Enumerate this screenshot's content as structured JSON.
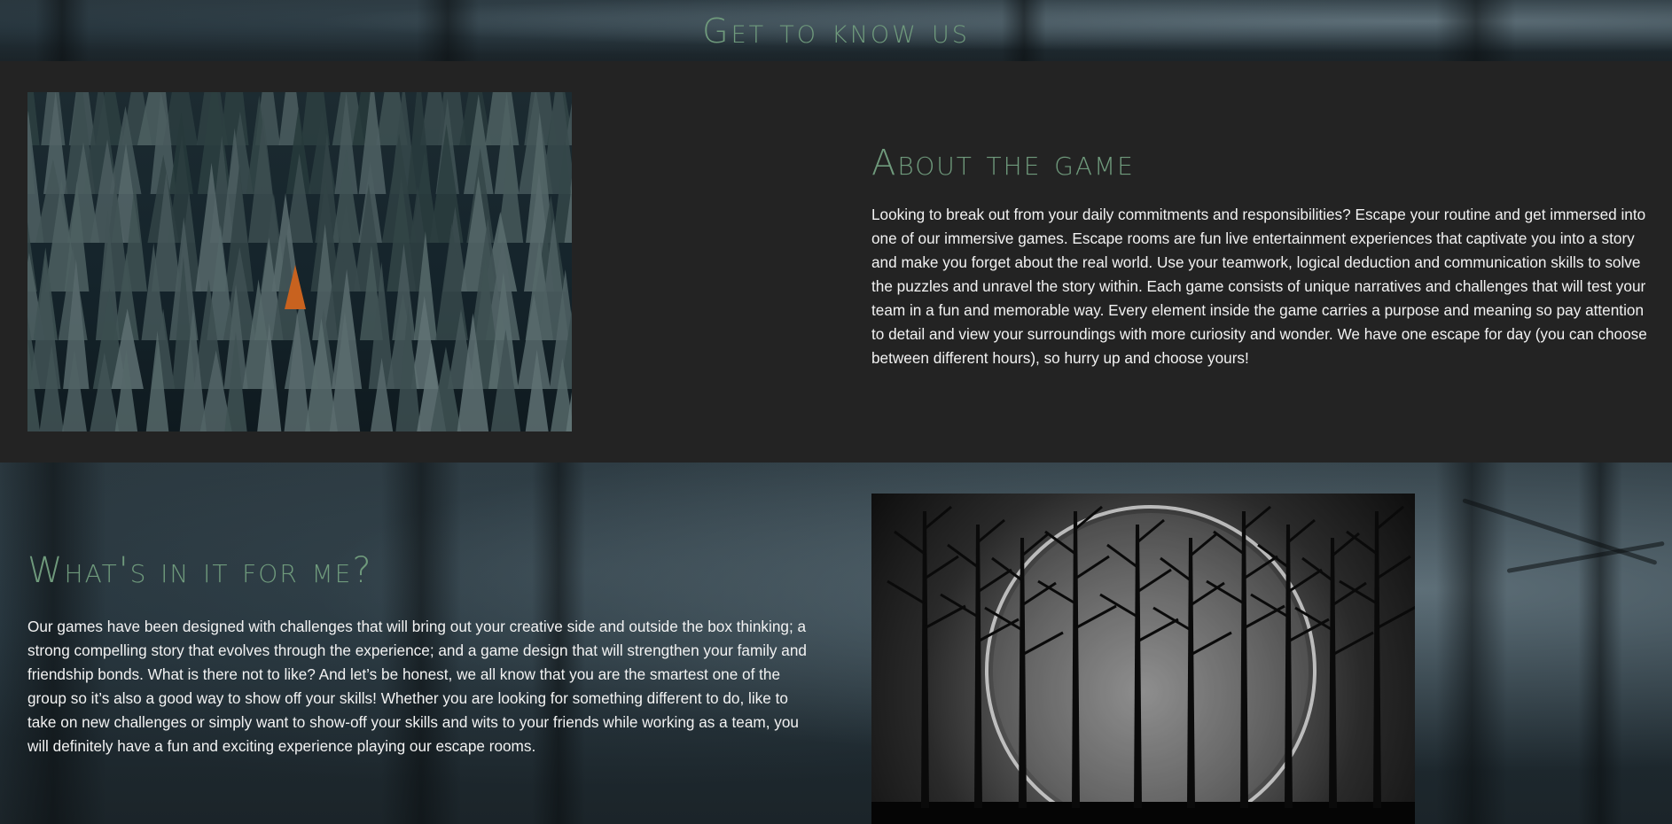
{
  "header": {
    "title": "Get to know us"
  },
  "about": {
    "heading": "About the game",
    "text": "Looking to break out from your daily commitments and responsibilities? Escape your routine and get immersed into one of our immersive games. Escape rooms are fun live entertainment experiences that captivate you into a story and make you forget about the real world. Use your teamwork, logical deduction and communication skills to solve the puzzles and unravel the story within. Each game consists of unique narratives and challenges that will test your team in a fun and memorable way. Every element inside the game carries a purpose and meaning so pay attention to detail and view your surroundings with more curiosity and wonder. We have one escape for day (you can choose between different hours), so hurry up and choose yours!",
    "image": "pine-forest-photo"
  },
  "whats_in_it": {
    "heading": "What's in it for me?",
    "text": "Our games have been designed with challenges that will bring out your creative side and outside the box thinking; a strong compelling story that evolves through the experience; and a game design that will strengthen your family and friendship bonds. What is there not to like? And let’s be honest, we all know that you are the smartest one of the group so it’s also a good way to show off your skills! Whether you are looking for something different to do, like to take on new challenges or simply want to show-off your skills and wits to your friends while working as a team, you will definitely have a fun and exciting experience playing our escape rooms.",
    "image": "moon-trees-photo"
  },
  "colors": {
    "heading": "#6f9a7c",
    "section_bg": "#232323",
    "text": "#f2f2f2"
  }
}
